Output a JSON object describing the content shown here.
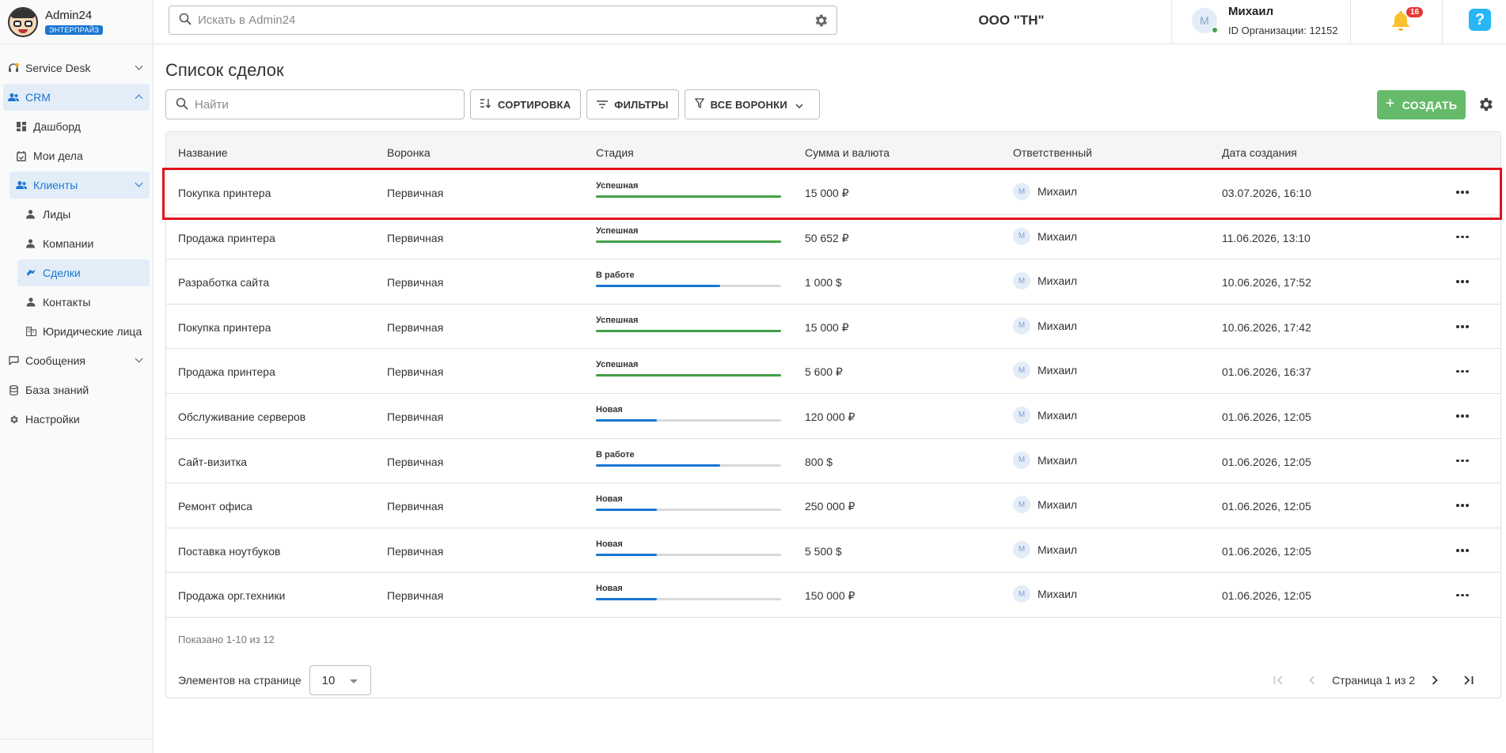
{
  "brand": {
    "name": "Admin24",
    "badge": "ЭНТЕРПРАЙЗ"
  },
  "sidebar": {
    "items": [
      {
        "label": "Service Desk",
        "icon": "headset-icon"
      },
      {
        "label": "CRM",
        "icon": "people-icon"
      },
      {
        "label": "Дашборд",
        "icon": "dashboard-icon"
      },
      {
        "label": "Мои дела",
        "icon": "calendar-check-icon"
      },
      {
        "label": "Клиенты",
        "icon": "people-icon"
      },
      {
        "label": "Лиды",
        "icon": "person-icon"
      },
      {
        "label": "Компании",
        "icon": "person-icon"
      },
      {
        "label": "Сделки",
        "icon": "handshake-icon"
      },
      {
        "label": "Контакты",
        "icon": "person-icon"
      },
      {
        "label": "Юридические лица",
        "icon": "building-icon"
      },
      {
        "label": "Сообщения",
        "icon": "chat-icon"
      },
      {
        "label": "База знаний",
        "icon": "database-icon"
      },
      {
        "label": "Настройки",
        "icon": "gear-icon"
      }
    ]
  },
  "header": {
    "search_placeholder": "Искать в Admin24",
    "org_title": "ООО \"ТН\"",
    "user_initial": "М",
    "user_name": "Михаил",
    "org_id": "ID Организации: 12152",
    "notifications": "16",
    "help": "?"
  },
  "main": {
    "title": "Список сделок",
    "find_placeholder": "Найти",
    "sort_label": "СОРТИРОВКА",
    "filters_label": "ФИЛЬТРЫ",
    "funnels_label": "ВСЕ ВОРОНКИ",
    "create_label": "СОЗДАТЬ"
  },
  "table": {
    "columns": [
      "Название",
      "Воронка",
      "Стадия",
      "Сумма и валюта",
      "Ответственный",
      "Дата создания"
    ],
    "rows": [
      {
        "name": "Покупка принтера",
        "funnel": "Первичная",
        "stage": "Успешная",
        "progress": 1.0,
        "amount": "15 000 ₽",
        "owner": "Михаил",
        "owner_initial": "М",
        "date": "03.07.2026, 16:10"
      },
      {
        "name": "Продажа принтера",
        "funnel": "Первичная",
        "stage": "Успешная",
        "progress": 1.0,
        "amount": "50 652 ₽",
        "owner": "Михаил",
        "owner_initial": "М",
        "date": "11.06.2026, 13:10"
      },
      {
        "name": "Разработка сайта",
        "funnel": "Первичная",
        "stage": "В работе",
        "progress": 0.67,
        "amount": "1 000 $",
        "owner": "Михаил",
        "owner_initial": "М",
        "date": "10.06.2026, 17:52"
      },
      {
        "name": "Покупка принтера",
        "funnel": "Первичная",
        "stage": "Успешная",
        "progress": 1.0,
        "amount": "15 000 ₽",
        "owner": "Михаил",
        "owner_initial": "М",
        "date": "10.06.2026, 17:42"
      },
      {
        "name": "Продажа принтера",
        "funnel": "Первичная",
        "stage": "Успешная",
        "progress": 1.0,
        "amount": "5 600 ₽",
        "owner": "Михаил",
        "owner_initial": "М",
        "date": "01.06.2026, 16:37"
      },
      {
        "name": "Обслуживание серверов",
        "funnel": "Первичная",
        "stage": "Новая",
        "progress": 0.33,
        "amount": "120 000 ₽",
        "owner": "Михаил",
        "owner_initial": "М",
        "date": "01.06.2026, 12:05"
      },
      {
        "name": "Сайт-визитка",
        "funnel": "Первичная",
        "stage": "В работе",
        "progress": 0.67,
        "amount": "800 $",
        "owner": "Михаил",
        "owner_initial": "М",
        "date": "01.06.2026, 12:05"
      },
      {
        "name": "Ремонт офиса",
        "funnel": "Первичная",
        "stage": "Новая",
        "progress": 0.33,
        "amount": "250 000 ₽",
        "owner": "Михаил",
        "owner_initial": "М",
        "date": "01.06.2026, 12:05"
      },
      {
        "name": "Поставка ноутбуков",
        "funnel": "Первичная",
        "stage": "Новая",
        "progress": 0.33,
        "amount": "5 500 $",
        "owner": "Михаил",
        "owner_initial": "М",
        "date": "01.06.2026, 12:05"
      },
      {
        "name": "Продажа орг.техники",
        "funnel": "Первичная",
        "stage": "Новая",
        "progress": 0.33,
        "amount": "150 000 ₽",
        "owner": "Михаил",
        "owner_initial": "М",
        "date": "01.06.2026, 12:05"
      }
    ]
  },
  "footer": {
    "shown": "Показано 1-10 из 12",
    "per_page_label": "Элементов на странице",
    "per_page_value": "10",
    "page_text": "Страница 1 из 2"
  },
  "colors": {
    "accent": "#1976d2",
    "success": "#43a047",
    "progress": "#1976d2",
    "create": "#66bb6a",
    "highlight": "#e3101a"
  }
}
